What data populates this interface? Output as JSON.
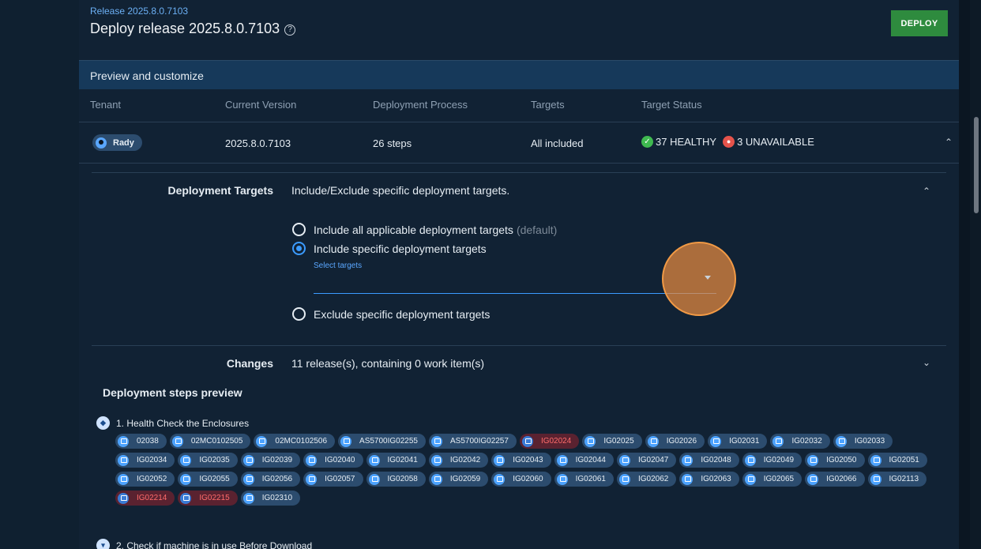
{
  "header": {
    "release_small": "Release 2025.8.0.7103",
    "title": "Deploy release 2025.8.0.7103",
    "help_glyph": "?",
    "deploy_label": "DEPLOY"
  },
  "preview": {
    "title": "Preview and customize",
    "columns": [
      "Tenant",
      "Current Version",
      "Deployment Process",
      "Targets",
      "Target Status"
    ],
    "row": {
      "tenant": "Rady",
      "version": "2025.8.0.7103",
      "process": "26 steps",
      "targets": "All included",
      "healthy": "37 HEALTHY",
      "unavailable": "3 UNAVAILABLE"
    }
  },
  "deployment_targets": {
    "label": "Deployment Targets",
    "description": "Include/Exclude specific deployment targets.",
    "option_all": "Include all applicable deployment targets",
    "option_all_suffix": "(default)",
    "option_specific": "Include specific deployment targets",
    "select_label": "Select targets",
    "option_exclude": "Exclude specific deployment targets",
    "selected": "Include specific deployment targets"
  },
  "changes": {
    "label": "Changes",
    "description": "11 release(s), containing 0 work item(s)"
  },
  "steps_preview": {
    "title": "Deployment steps preview",
    "steps": [
      {
        "label": "1. Health Check the Enclosures",
        "machines": [
          {
            "name": "02038",
            "status": "ok"
          },
          {
            "name": "02MC0102505",
            "status": "ok"
          },
          {
            "name": "02MC0102506",
            "status": "ok"
          },
          {
            "name": "AS5700IG02255",
            "status": "ok"
          },
          {
            "name": "AS5700IG02257",
            "status": "ok"
          },
          {
            "name": "IG02024",
            "status": "unavailable"
          },
          {
            "name": "IG02025",
            "status": "ok"
          },
          {
            "name": "IG02026",
            "status": "ok"
          },
          {
            "name": "IG02031",
            "status": "ok"
          },
          {
            "name": "IG02032",
            "status": "ok"
          },
          {
            "name": "IG02033",
            "status": "ok"
          },
          {
            "name": "IG02034",
            "status": "ok"
          },
          {
            "name": "IG02035",
            "status": "ok"
          },
          {
            "name": "IG02039",
            "status": "ok"
          },
          {
            "name": "IG02040",
            "status": "ok"
          },
          {
            "name": "IG02041",
            "status": "ok"
          },
          {
            "name": "IG02042",
            "status": "ok"
          },
          {
            "name": "IG02043",
            "status": "ok"
          },
          {
            "name": "IG02044",
            "status": "ok"
          },
          {
            "name": "IG02047",
            "status": "ok"
          },
          {
            "name": "IG02048",
            "status": "ok"
          },
          {
            "name": "IG02049",
            "status": "ok"
          },
          {
            "name": "IG02050",
            "status": "ok"
          },
          {
            "name": "IG02051",
            "status": "ok"
          },
          {
            "name": "IG02052",
            "status": "ok"
          },
          {
            "name": "IG02055",
            "status": "ok"
          },
          {
            "name": "IG02056",
            "status": "ok"
          },
          {
            "name": "IG02057",
            "status": "ok"
          },
          {
            "name": "IG02058",
            "status": "ok"
          },
          {
            "name": "IG02059",
            "status": "ok"
          },
          {
            "name": "IG02060",
            "status": "ok"
          },
          {
            "name": "IG02061",
            "status": "ok"
          },
          {
            "name": "IG02062",
            "status": "ok"
          },
          {
            "name": "IG02063",
            "status": "ok"
          },
          {
            "name": "IG02065",
            "status": "ok"
          },
          {
            "name": "IG02066",
            "status": "ok"
          },
          {
            "name": "IG02113",
            "status": "ok"
          },
          {
            "name": "IG02214",
            "status": "unavailable"
          },
          {
            "name": "IG02215",
            "status": "unavailable"
          },
          {
            "name": "IG02310",
            "status": "ok"
          }
        ]
      },
      {
        "label": "2. Check if machine is in use Before Download",
        "machines": []
      }
    ]
  },
  "colors": {
    "accent": "#3b9bff",
    "deploy": "#2e8b3e",
    "healthy": "#3fb950",
    "unavailable": "#e5534b",
    "cursor_halo": "#f29a45"
  }
}
